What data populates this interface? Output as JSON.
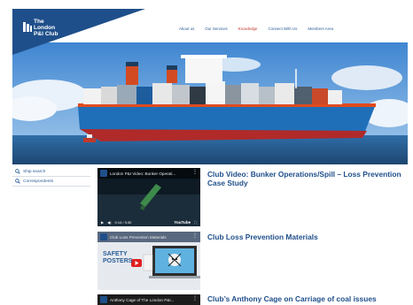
{
  "header": {
    "logo_lines": [
      "The",
      "London",
      "P&I Club"
    ],
    "nav": [
      {
        "label": "About us",
        "active": false
      },
      {
        "label": "Our Services",
        "active": false
      },
      {
        "label": "Knowledge",
        "active": true
      },
      {
        "label": "Connect With Us",
        "active": false
      },
      {
        "label": "Members Area",
        "active": false
      }
    ]
  },
  "colors": {
    "brand": "#1f4f8a",
    "accent": "#c0392b",
    "hull": "#1f6fb8",
    "sea": "#244f7e"
  },
  "sidebar": {
    "items": [
      {
        "label": "Ship search",
        "icon": "search-icon"
      },
      {
        "label": "Correspondents",
        "icon": "search-icon"
      }
    ]
  },
  "videos": [
    {
      "thumb_title": "London P&I Video: Bunker Operati...",
      "time": "0:14 / 3:30",
      "brand": "YouTube",
      "heading": "Club Video: Bunker Operations/Spill – Loss Prevention Case Study"
    },
    {
      "thumb_title": "Club Loss Prevention Materials",
      "poster_text": "SAFETY POSTERS",
      "heading": "Club Loss Prevention Materials"
    },
    {
      "thumb_title": "Anthony Cage of The London P&I...",
      "heading": "Club’s Anthony Cage on Carriage of coal issues"
    }
  ]
}
